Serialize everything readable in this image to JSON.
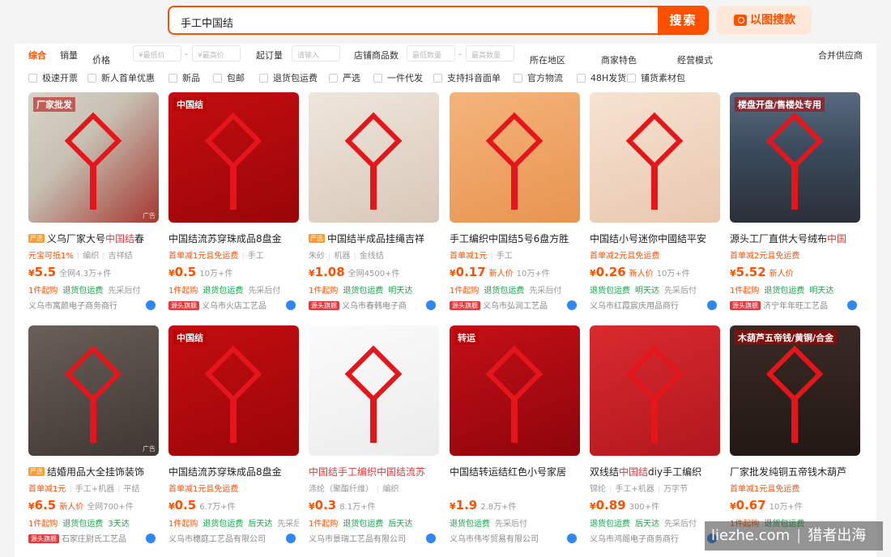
{
  "search": {
    "query": "手工中国结",
    "button": "搜索",
    "image_search": "以图搜款"
  },
  "sort": {
    "items": [
      "综合",
      "销量",
      "价格"
    ],
    "price_min": "¥最低价",
    "price_max": "¥最高价",
    "moq_label": "起订量",
    "moq_placeholder": "请输入",
    "shop_goods_label": "店铺商品数",
    "shop_min": "最低数量",
    "shop_max": "最高数量",
    "region": "所在地区",
    "merchant": "商家特色",
    "mode": "经营模式",
    "supplier": "合并供应商"
  },
  "checks": [
    "极速开票",
    "新人首单优惠",
    "新品",
    "包邮",
    "退货包运费",
    "严选",
    "一件代发",
    "支持抖音面单",
    "官方物流",
    "48H发货",
    "铺货素材包"
  ],
  "products": [
    {
      "tag": "严选",
      "title_pre": "义乌厂家大号",
      "title_hl": "中国结",
      "title_post": "春",
      "sub": [
        "元宝可抵1%",
        "编织",
        "吉祥结"
      ],
      "price": "5.5",
      "meta": "全网4.3万+件",
      "svc": [
        "1件起购",
        "退货包运费",
        "先采后付"
      ],
      "shop": "义乌市寓颜电子商务商行",
      "badge": "",
      "img_text": "厂家批发",
      "ad": "广告"
    },
    {
      "tag": "",
      "title_pre": "中国结流苏穿珠成品8盘金",
      "title_hl": "",
      "title_post": "",
      "sub": [
        "首单减1元且免运费",
        "手工"
      ],
      "price": "0.5",
      "meta": "10万+件",
      "svc": [
        "1件起购",
        "退货包运费",
        "先采后付"
      ],
      "shop": "义乌市火店工艺品",
      "badge": "源头旗舰",
      "img_text": "中国结",
      "ad": ""
    },
    {
      "tag": "严选",
      "title_pre": "中国结半成品挂绳吉祥",
      "title_hl": "",
      "title_post": "",
      "sub": [
        "朱砂",
        "机器",
        "金线结"
      ],
      "price": "1.08",
      "meta": "全网4500+件",
      "svc": [
        "1件起购",
        "退货包运费",
        "明天达"
      ],
      "shop": "义乌市春韩电子商",
      "badge": "源头旗舰",
      "img_text": "",
      "ad": ""
    },
    {
      "tag": "",
      "title_pre": "手工编织中国结5号6盘方胜",
      "title_hl": "",
      "title_post": "",
      "sub": [
        "首单减1元",
        "手工"
      ],
      "price": "0.17",
      "meta": "新人价",
      "meta2": "10万+件",
      "svc": [
        "1件起购",
        "退货包运费",
        "先采后付"
      ],
      "shop": "义乌市弘润工艺品",
      "badge": "源头旗舰",
      "img_text": "",
      "ad": ""
    },
    {
      "tag": "",
      "title_pre": "中国结小号迷你中國結平安",
      "title_hl": "",
      "title_post": "",
      "sub": [
        "首单减2元且免运费"
      ],
      "price": "0.26",
      "meta": "新人价",
      "meta2": "10万+件",
      "svc": [
        "退货包运费",
        "明天达",
        "先采后付"
      ],
      "shop": "义乌市红霞宸庆用品商行",
      "badge": "",
      "img_text": "",
      "ad": ""
    },
    {
      "tag": "",
      "title_pre": "源头工厂直供大号绒布",
      "title_hl": "中国",
      "title_post": "",
      "sub": [
        "首单减2元且免运费"
      ],
      "price": "5.52",
      "meta": "新人价",
      "svc": [
        "1件起购",
        "退货包运费",
        "明天达"
      ],
      "shop": "济宁年年旺工艺品",
      "badge": "源头旗舰",
      "img_text": "楼盘开盘/售楼处专用",
      "ad": ""
    },
    {
      "tag": "严选",
      "title_pre": "结婚用品大全挂饰装饰",
      "title_hl": "",
      "title_post": "",
      "sub": [
        "首单减1元",
        "手工+机器",
        "平结"
      ],
      "price": "6.5",
      "meta": "新人价",
      "meta2": "全网700+件",
      "svc": [
        "1件起购",
        "退货包运费",
        "3天达"
      ],
      "shop": "石家庄尉氏工艺品",
      "badge": "源头旗舰",
      "img_text": "",
      "ad": "广告"
    },
    {
      "tag": "",
      "title_pre": "中国结流苏穿珠成品8盘金",
      "title_hl": "",
      "title_post": "",
      "sub": [
        "首单减1元且免运费"
      ],
      "price": "0.5",
      "meta": "6.7万+件",
      "svc": [
        "1件起购",
        "退货包运费",
        "后天达",
        "先采后付"
      ],
      "shop": "义乌市穗庭工艺品有限公司",
      "badge": "",
      "img_text": "中国结",
      "ad": ""
    },
    {
      "tag": "",
      "title_pre": "",
      "title_hl": "中国结手工编织中国结流苏",
      "title_post": "",
      "sub": [
        "涤纶（聚酯纤维）",
        "编织"
      ],
      "price": "0.3",
      "meta": "8.1万+件",
      "svc": [
        "1件起购",
        "退货包运费",
        "后天达"
      ],
      "shop": "义乌市景瑞工艺品有限公司",
      "badge": "",
      "img_text": "",
      "ad": ""
    },
    {
      "tag": "",
      "title_pre": "中国结转运结红色小号家居",
      "title_hl": "",
      "title_post": "",
      "sub": [],
      "price": "1.9",
      "meta": "2.8万+件",
      "svc": [
        "退货包运费",
        "先采后付"
      ],
      "shop": "义乌市伟岑贸易有限公司",
      "badge": "",
      "img_text": "转运",
      "ad": ""
    },
    {
      "tag": "",
      "title_pre": "双线结",
      "title_hl": "中国结",
      "title_post": "diy手工编织",
      "sub": [
        "锦纶",
        "手工+机器",
        "万字节"
      ],
      "price": "0.89",
      "meta": "300+件",
      "svc": [
        "退货包运费",
        "后天达",
        "先采后付"
      ],
      "shop": "义乌市鸿阁电子商务商行",
      "badge": "",
      "img_text": "",
      "ad": ""
    },
    {
      "tag": "",
      "title_pre": "厂家批发纯铜五帝钱木葫芦",
      "title_hl": "",
      "title_post": "",
      "sub": [
        "首单减1元且免运费"
      ],
      "price": "0.67",
      "meta": "10万+件",
      "svc": [
        "1件起购",
        "退货包运费"
      ],
      "shop": "",
      "badge": "",
      "img_text": "木葫芦五帝钱/黄铜/合金",
      "ad": ""
    }
  ],
  "watermark": {
    "left": "liezhe.com",
    "right": "猎者出海"
  }
}
